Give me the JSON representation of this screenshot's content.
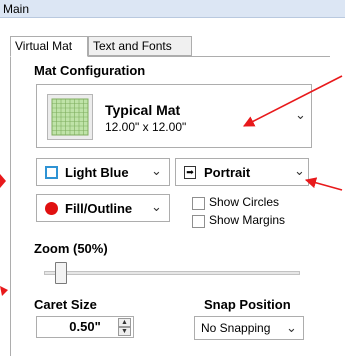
{
  "window": {
    "title": "Main"
  },
  "tabs": [
    {
      "label": "Virtual Mat",
      "active": true
    },
    {
      "label": "Text and Fonts",
      "active": false
    }
  ],
  "mat_config": {
    "heading": "Mat Configuration",
    "mat_name": "Typical Mat",
    "mat_size": "12.00\" x 12.00\""
  },
  "mat_color": {
    "value": "Light Blue",
    "swatch_color": "#2f93d4"
  },
  "orientation": {
    "value": "Portrait"
  },
  "display_mode": {
    "value": "Fill/Outline",
    "dot_color": "#e01010"
  },
  "options": {
    "show_circles": {
      "label": "Show Circles",
      "checked": false
    },
    "show_margins": {
      "label": "Show Margins",
      "checked": false
    }
  },
  "zoom": {
    "label": "Zoom (50%)",
    "level_fraction": 0.06
  },
  "caret": {
    "label": "Caret Size",
    "value": "0.50\""
  },
  "snap": {
    "label": "Snap Position",
    "value": "No Snapping"
  },
  "colors": {
    "annotation_arrow": "#e8191b",
    "accent": "#2f93d4",
    "title_bar": "#dce6f4"
  }
}
